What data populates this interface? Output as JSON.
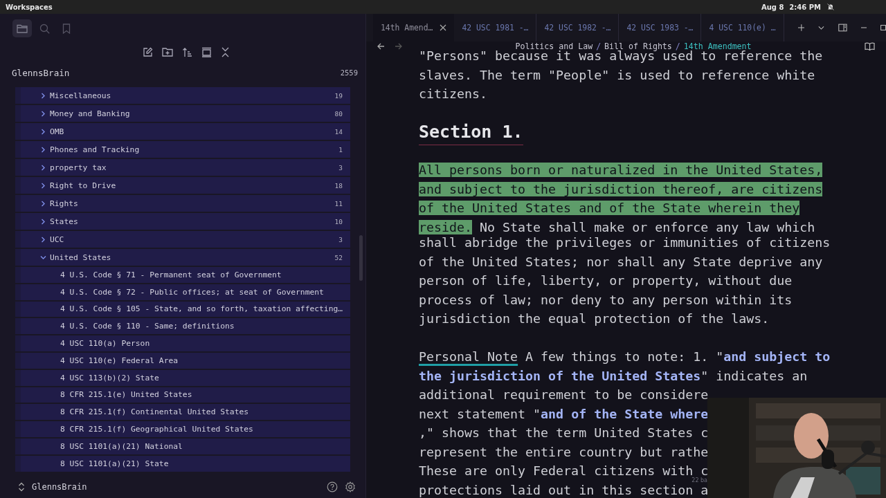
{
  "top_bar": {
    "title": "Workspaces",
    "date": "Aug 8",
    "time": "2:46 PM"
  },
  "sidebar": {
    "nav": [
      {
        "kind": "files",
        "selected": true
      },
      {
        "kind": "search",
        "selected": false
      },
      {
        "kind": "bookmarks",
        "selected": false
      }
    ],
    "vault_name": "GlennsBrain",
    "file_count": "2559",
    "tree": [
      {
        "kind": "folder",
        "label": "Miscellaneous",
        "count": "19",
        "expanded": false
      },
      {
        "kind": "folder",
        "label": "Money and Banking",
        "count": "80",
        "expanded": false
      },
      {
        "kind": "folder",
        "label": "OMB",
        "count": "14",
        "expanded": false
      },
      {
        "kind": "folder",
        "label": "Phones and Tracking",
        "count": "1",
        "expanded": false
      },
      {
        "kind": "folder",
        "label": "property tax",
        "count": "3",
        "expanded": false
      },
      {
        "kind": "folder",
        "label": "Right to Drive",
        "count": "18",
        "expanded": false
      },
      {
        "kind": "folder",
        "label": "Rights",
        "count": "11",
        "expanded": false
      },
      {
        "kind": "folder",
        "label": "States",
        "count": "10",
        "expanded": false
      },
      {
        "kind": "folder",
        "label": "UCC",
        "count": "3",
        "expanded": false
      },
      {
        "kind": "folder",
        "label": "United States",
        "count": "52",
        "expanded": true,
        "children": [
          {
            "kind": "file",
            "label": "4 U.S. Code § 71 - Permanent seat of Government"
          },
          {
            "kind": "file",
            "label": "4 U.S. Code § 72 - Public offices; at seat of Government"
          },
          {
            "kind": "file",
            "label": "4 U.S. Code § 105 - State, and so forth, taxation affecting…"
          },
          {
            "kind": "file",
            "label": "4 U.S. Code § 110 - Same; definitions"
          },
          {
            "kind": "file",
            "label": "4 USC 110(a) Person"
          },
          {
            "kind": "file",
            "label": "4 USC 110(e) Federal Area"
          },
          {
            "kind": "file",
            "label": "4 USC 113(b)(2) State"
          },
          {
            "kind": "file",
            "label": "8 CFR 215.1(e) United States"
          },
          {
            "kind": "file",
            "label": "8 CFR 215.1(f) Continental United States"
          },
          {
            "kind": "file",
            "label": "8 CFR 215.1(f) Geographical United States"
          },
          {
            "kind": "file",
            "label": "8 USC 1101(a)(21) National"
          },
          {
            "kind": "file",
            "label": "8 USC 1101(a)(21) State"
          }
        ]
      }
    ],
    "footer_vault": "GlennsBrain"
  },
  "tabs": [
    {
      "label": "14th Amend…",
      "selected": true
    },
    {
      "label": "42 USC 1981 -…",
      "selected": false
    },
    {
      "label": "42 USC 1982 -…",
      "selected": false
    },
    {
      "label": "42 USC 1983 -…",
      "selected": false
    },
    {
      "label": "4 USC 110(e) …",
      "selected": false
    }
  ],
  "breadcrumb": [
    {
      "label": "Politics and Law",
      "current": false
    },
    {
      "separator": "/",
      "label": "Bill of Rights",
      "current": false
    },
    {
      "separator": "/",
      "label": "14th Amendment",
      "current": true
    }
  ],
  "document": {
    "blocks": [
      {
        "kind": "paragraph",
        "lines": [
          [
            {
              "kind": "plain",
              "text": "\"Persons\" because it was always used to reference the"
            }
          ],
          [
            {
              "kind": "plain",
              "text": "slaves. The term \"People\" is used to reference white"
            }
          ],
          [
            {
              "kind": "plain",
              "text": "citizens."
            }
          ]
        ]
      },
      {
        "kind": "heading",
        "text": "Section 1."
      },
      {
        "kind": "paragraph",
        "lines": [
          [
            {
              "kind": "highlight",
              "text": "All persons born or naturalized in the United States,"
            }
          ],
          [
            {
              "kind": "highlight",
              "text": "and subject to the jurisdiction thereof, are citizens"
            }
          ],
          [
            {
              "kind": "highlight",
              "text": "of the United States and of the State wherein they"
            }
          ],
          [
            {
              "kind": "highlight",
              "text": "reside."
            },
            {
              "kind": "plain",
              "text": " No State shall make or enforce any law which"
            }
          ],
          [
            {
              "kind": "plain",
              "text": "shall abridge the privileges or immunities of citizens"
            }
          ],
          [
            {
              "kind": "plain",
              "text": "of the United States; nor shall any State deprive any"
            }
          ],
          [
            {
              "kind": "plain",
              "text": "person of life, liberty, or property, without due"
            }
          ],
          [
            {
              "kind": "plain",
              "text": "process of law; nor deny to any person within its"
            }
          ],
          [
            {
              "kind": "plain",
              "text": "jurisdiction the equal protection of the laws."
            }
          ]
        ]
      },
      {
        "kind": "paragraph",
        "lines": [
          [
            {
              "kind": "link",
              "text": "Personal Note"
            },
            {
              "kind": "plain",
              "text": " A few things to note: 1. \""
            },
            {
              "kind": "bold",
              "text": "and subject to"
            }
          ],
          [
            {
              "kind": "bold",
              "text": "the jurisdiction of the United States"
            },
            {
              "kind": "plain",
              "text": "\" indicates an"
            }
          ],
          [
            {
              "kind": "plain",
              "text": "additional requirement to be considere"
            }
          ],
          [
            {
              "kind": "plain",
              "text": "next statement \""
            },
            {
              "kind": "bold",
              "text": "and of the State where"
            }
          ],
          [
            {
              "kind": "plain",
              "text": ",\" shows that the term United States c"
            }
          ],
          [
            {
              "kind": "plain",
              "text": "represent the entire country but rathe"
            }
          ],
          [
            {
              "kind": "plain",
              "text": "These are only Federal citizens with c"
            }
          ],
          [
            {
              "kind": "plain",
              "text": "protections laid out in this section a"
            }
          ]
        ]
      }
    ],
    "status": "22 ba"
  }
}
